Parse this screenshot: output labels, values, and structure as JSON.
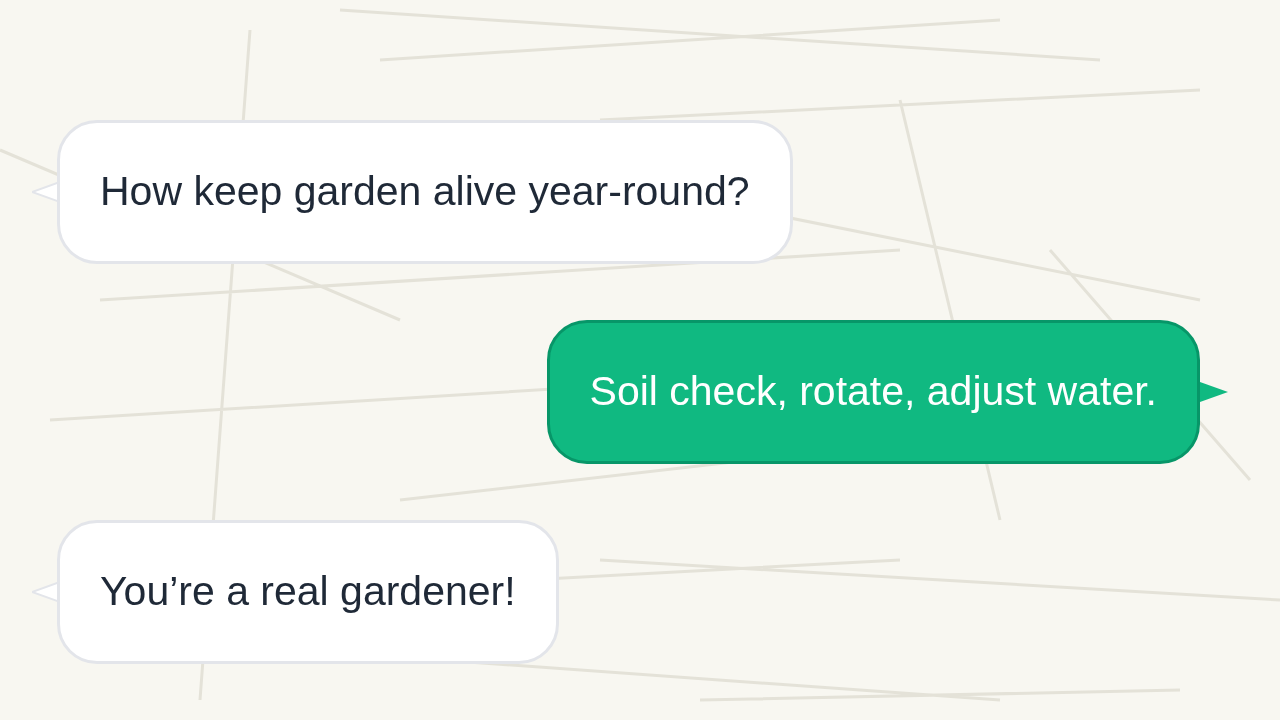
{
  "messages": [
    {
      "kind": "received",
      "text": "How keep garden alive year-round?"
    },
    {
      "kind": "sent",
      "text": "Soil check, rotate, adjust water."
    },
    {
      "kind": "received",
      "text": "You’re a real gardener!"
    }
  ]
}
